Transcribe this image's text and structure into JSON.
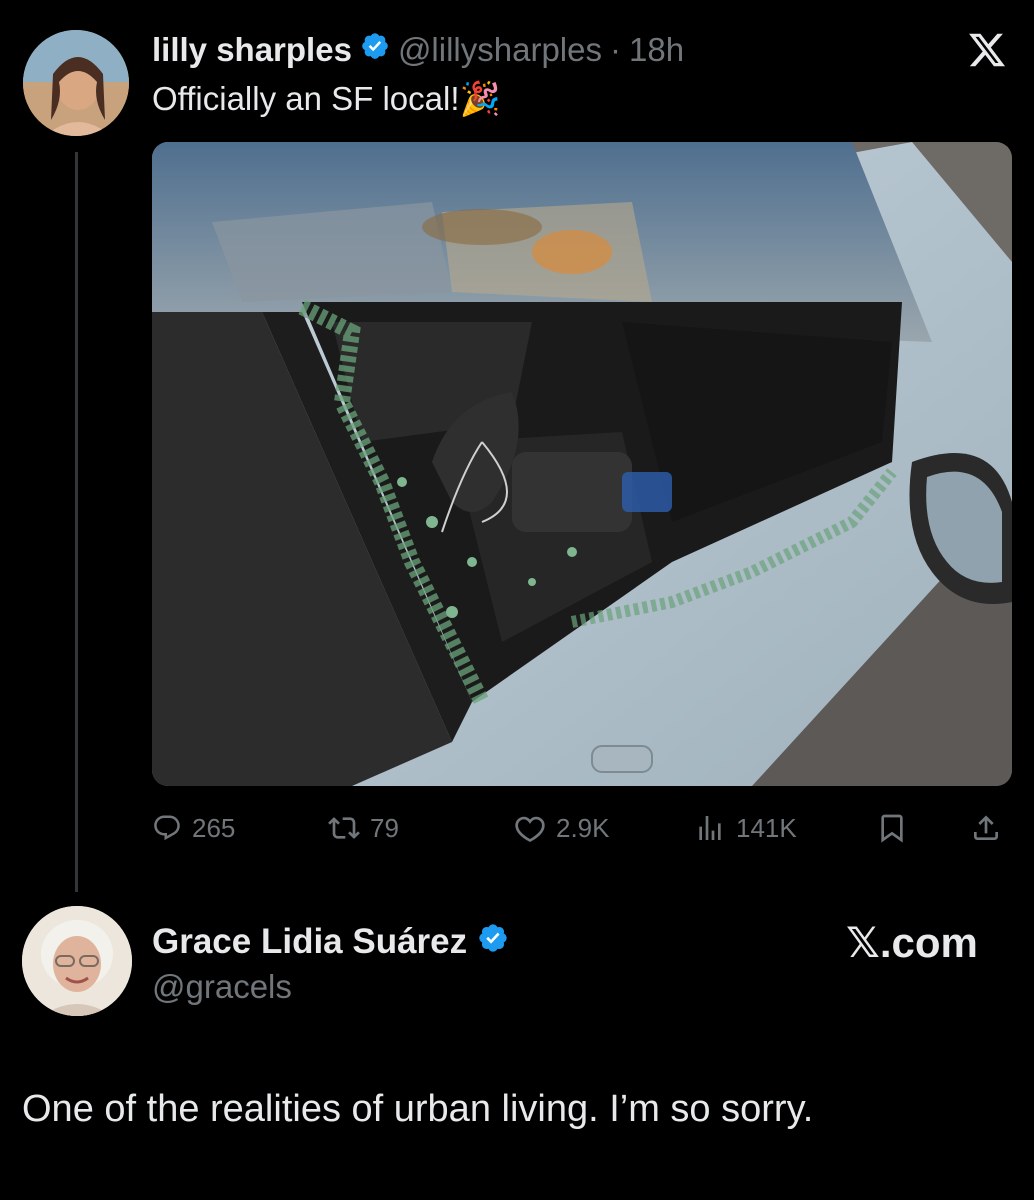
{
  "tweet": {
    "display_name": "lilly sharples",
    "handle": "@lillysharples",
    "separator": "·",
    "time": "18h",
    "text": "Officially an SF local!",
    "emoji": "🎉",
    "stats": {
      "replies": "265",
      "reposts": "79",
      "likes": "2.9K",
      "views": "141K"
    }
  },
  "reply": {
    "display_name": "Grace Lidia Suárez",
    "handle": "@gracels",
    "brand": "𝕏.com",
    "text": "One of the realities of urban living. I’m so sorry."
  },
  "icons": {
    "x_logo": "x-logo-icon",
    "verified": "verified-badge-icon",
    "reply": "reply-icon",
    "repost": "repost-icon",
    "like": "heart-icon",
    "views": "views-chart-icon",
    "bookmark": "bookmark-icon",
    "share": "share-icon"
  },
  "colors": {
    "background": "#000000",
    "text": "#e7e9ea",
    "muted": "#71767b",
    "verified": "#1d9bf0",
    "thread_line": "#333639"
  }
}
